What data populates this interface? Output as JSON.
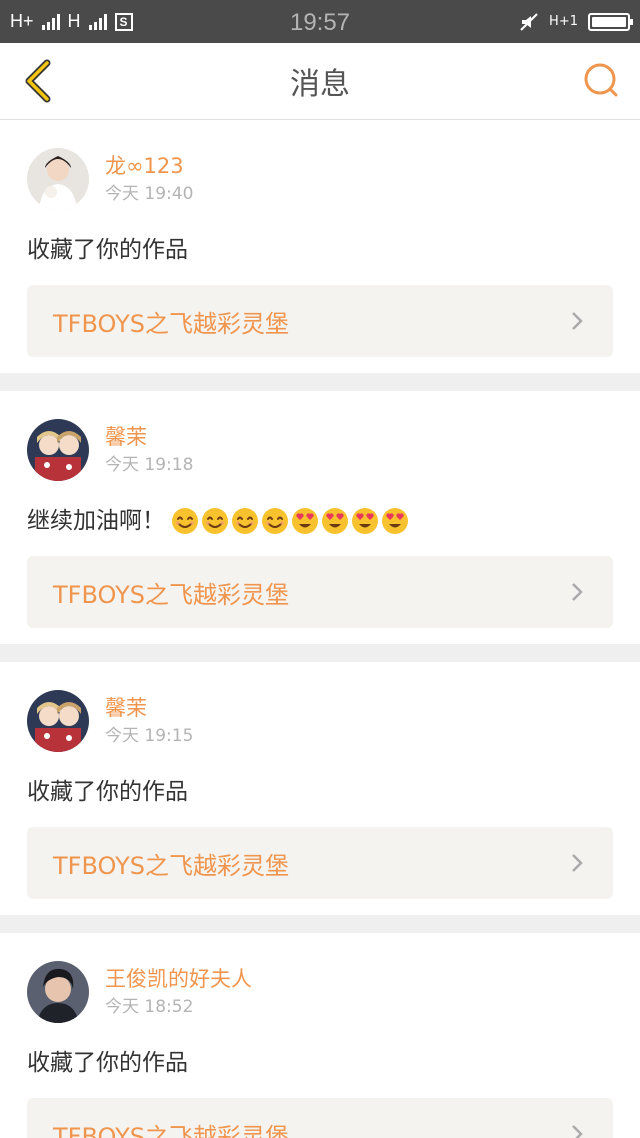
{
  "status_bar": {
    "network_left": "H+",
    "network_right": "H",
    "time": "19:57",
    "network_small": "H+1"
  },
  "nav": {
    "title": "消息"
  },
  "messages": [
    {
      "username": "龙∞123",
      "time": "今天 19:40",
      "text": "收藏了你的作品",
      "emojis": [],
      "work_title": "TFBOYS之飞越彩灵堡",
      "avatar": "portrait-white-dress"
    },
    {
      "username": "馨茉",
      "time": "今天 19:18",
      "text": "继续加油啊！",
      "emojis": [
        "smile",
        "smile",
        "smile",
        "smile",
        "heart-eyes",
        "heart-eyes",
        "heart-eyes",
        "heart-eyes"
      ],
      "work_title": "TFBOYS之飞越彩灵堡",
      "avatar": "anime-girls"
    },
    {
      "username": "馨茉",
      "time": "今天 19:15",
      "text": "收藏了你的作品",
      "emojis": [],
      "work_title": "TFBOYS之飞越彩灵堡",
      "avatar": "anime-girls"
    },
    {
      "username": "王俊凯的好夫人",
      "time": "今天 18:52",
      "text": "收藏了你的作品",
      "emojis": [],
      "work_title": "TFBOYS之飞越彩灵堡",
      "avatar": "portrait-boy-dark"
    }
  ],
  "colors": {
    "accent": "#f0954d",
    "status_bar_bg": "#4a4a4a"
  }
}
